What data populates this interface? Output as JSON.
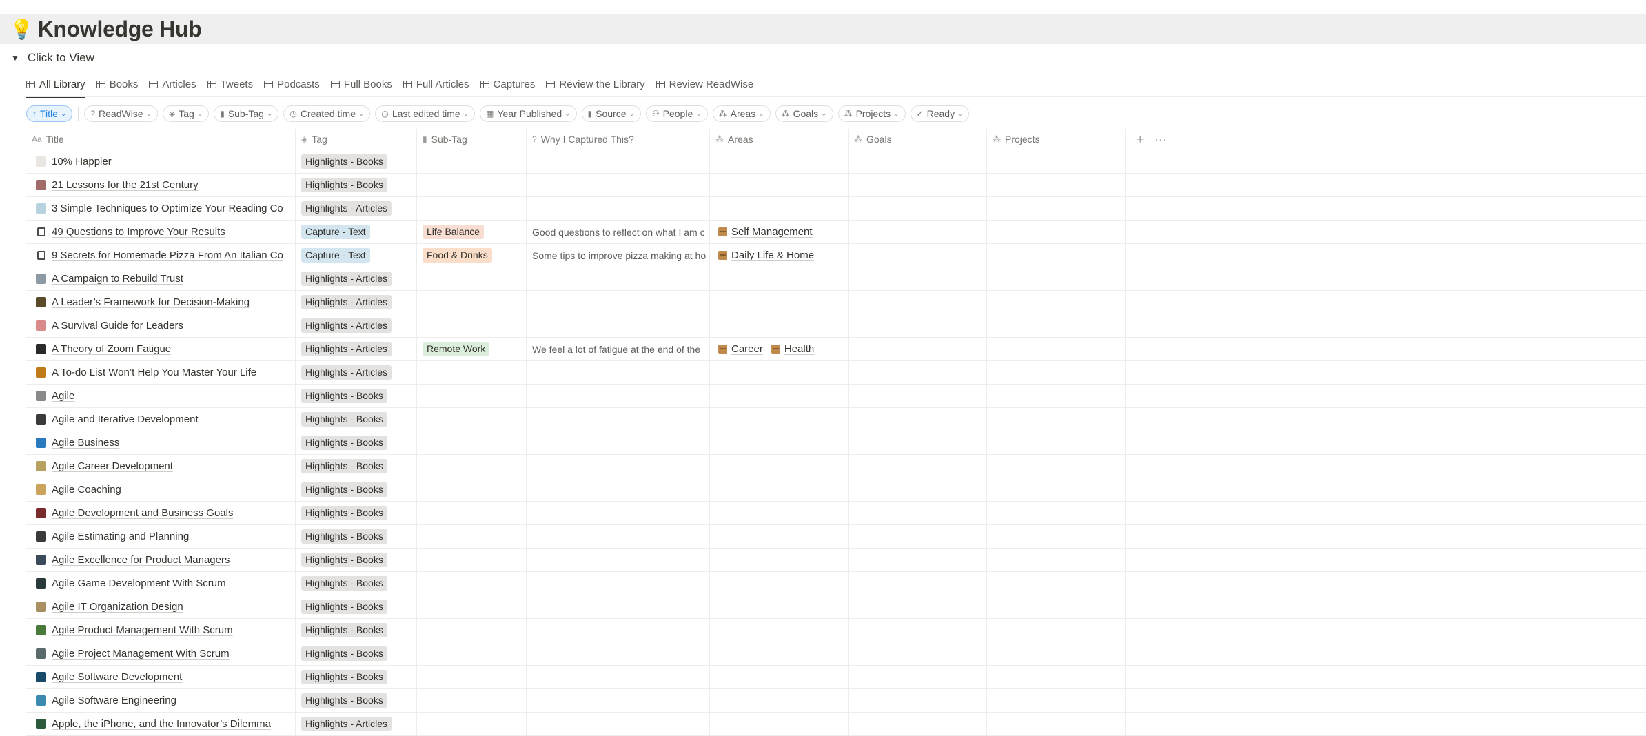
{
  "page": {
    "icon": "lightbulb-icon",
    "title": "Knowledge Hub"
  },
  "toggle": {
    "label": "Click to View"
  },
  "views": [
    {
      "label": "All Library",
      "active": true
    },
    {
      "label": "Books"
    },
    {
      "label": "Articles"
    },
    {
      "label": "Tweets"
    },
    {
      "label": "Podcasts"
    },
    {
      "label": "Full Books"
    },
    {
      "label": "Full Articles"
    },
    {
      "label": "Captures"
    },
    {
      "label": "Review the Library"
    },
    {
      "label": "Review ReadWise"
    }
  ],
  "filters": {
    "sort": {
      "label": "Title",
      "icon": "arrow-up-icon"
    },
    "items": [
      {
        "label": "ReadWise",
        "icon": "question-icon",
        "glyph": "?"
      },
      {
        "label": "Tag",
        "icon": "tag-icon",
        "glyph": "◈"
      },
      {
        "label": "Sub-Tag",
        "icon": "bag-icon",
        "glyph": "▮"
      },
      {
        "label": "Created time",
        "icon": "clock-icon",
        "glyph": "◷"
      },
      {
        "label": "Last edited time",
        "icon": "clock-icon",
        "glyph": "◷"
      },
      {
        "label": "Year Published",
        "icon": "calendar-icon",
        "glyph": "▦"
      },
      {
        "label": "Source",
        "icon": "bag-icon",
        "glyph": "▮"
      },
      {
        "label": "People",
        "icon": "people-icon",
        "glyph": "⚇"
      },
      {
        "label": "Areas",
        "icon": "relation-icon",
        "glyph": "⁂"
      },
      {
        "label": "Goals",
        "icon": "relation-icon",
        "glyph": "⁂"
      },
      {
        "label": "Projects",
        "icon": "relation-icon",
        "glyph": "⁂"
      },
      {
        "label": "Ready",
        "icon": "check-circle-icon",
        "glyph": "✓"
      }
    ]
  },
  "columns": {
    "title": "Title",
    "tag": "Tag",
    "subtag": "Sub-Tag",
    "why": "Why I Captured This?",
    "areas": "Areas",
    "goals": "Goals",
    "projects": "Projects"
  },
  "colors": {
    "tag_gray": "#e3e2e0",
    "tag_blue": "#d3e5ef",
    "life_balance": "#f7ddd2",
    "food_drinks": "#fadec9",
    "remote_work": "#dbeddb",
    "accent": "#2383e2"
  },
  "rows": [
    {
      "title": "10% Happier",
      "tag": "Highlights - Books",
      "thumb": "#e9e6e1"
    },
    {
      "title": "21 Lessons for the 21st Century",
      "tag": "Highlights - Books",
      "thumb": "#a36a6a"
    },
    {
      "title": "3 Simple Techniques to Optimize Your Reading Co",
      "tag": "Highlights - Articles",
      "thumb": "#b7d3df"
    },
    {
      "title": "49 Questions to Improve Your Results",
      "tag": "Capture - Text",
      "tag_color": "blue",
      "subtag": "Life Balance",
      "subtag_color": "life_balance",
      "why": "Good questions to reflect on what I am c",
      "areas": [
        "Self Management"
      ],
      "thumb": "#4b4b4b",
      "doc": true
    },
    {
      "title": "9 Secrets for Homemade Pizza From An Italian Co",
      "tag": "Capture - Text",
      "tag_color": "blue",
      "subtag": "Food & Drinks",
      "subtag_color": "food_drinks",
      "why": "Some tips to improve pizza making at ho",
      "areas": [
        "Daily Life & Home"
      ],
      "thumb": "#4b4b4b",
      "doc": true
    },
    {
      "title": "A Campaign to Rebuild Trust",
      "tag": "Highlights - Articles",
      "thumb": "#8c9aa6"
    },
    {
      "title": "A Leader’s Framework for Decision-Making",
      "tag": "Highlights - Articles",
      "thumb": "#5a4a2a"
    },
    {
      "title": "A Survival Guide for Leaders",
      "tag": "Highlights - Articles",
      "thumb": "#d98a8a"
    },
    {
      "title": "A Theory of Zoom Fatigue",
      "tag": "Highlights - Articles",
      "subtag": "Remote Work",
      "subtag_color": "remote_work",
      "why": "We feel a lot of fatigue at the end of the",
      "areas": [
        "Career",
        "Health"
      ],
      "thumb": "#2a2a2a"
    },
    {
      "title": "A To-do List Won’t Help You Master Your Life",
      "tag": "Highlights - Articles",
      "thumb": "#c07a1a"
    },
    {
      "title": "Agile",
      "tag": "Highlights - Books",
      "thumb": "#8a8a8a"
    },
    {
      "title": "Agile and Iterative Development",
      "tag": "Highlights - Books",
      "thumb": "#3a3a3a"
    },
    {
      "title": "Agile Business",
      "tag": "Highlights - Books",
      "thumb": "#2a7ac0"
    },
    {
      "title": "Agile Career Development",
      "tag": "Highlights - Books",
      "thumb": "#b8a060"
    },
    {
      "title": "Agile Coaching",
      "tag": "Highlights - Books",
      "thumb": "#c9a45a"
    },
    {
      "title": "Agile Development and Business Goals",
      "tag": "Highlights - Books",
      "thumb": "#7a2a2a"
    },
    {
      "title": "Agile Estimating and Planning",
      "tag": "Highlights - Books",
      "thumb": "#3a3a3a"
    },
    {
      "title": "Agile Excellence for Product Managers",
      "tag": "Highlights - Books",
      "thumb": "#3a4a5a"
    },
    {
      "title": "Agile Game Development With Scrum",
      "tag": "Highlights - Books",
      "thumb": "#2a3a3a"
    },
    {
      "title": "Agile IT Organization Design",
      "tag": "Highlights - Books",
      "thumb": "#a89060"
    },
    {
      "title": "Agile Product Management With Scrum",
      "tag": "Highlights - Books",
      "thumb": "#4a7a3a"
    },
    {
      "title": "Agile Project Management With Scrum",
      "tag": "Highlights - Books",
      "thumb": "#5a6a6a"
    },
    {
      "title": "Agile Software Development",
      "tag": "Highlights - Books",
      "thumb": "#1a4a6a"
    },
    {
      "title": "Agile Software Engineering",
      "tag": "Highlights - Books",
      "thumb": "#3a8ab0"
    },
    {
      "title": "Apple, the iPhone, and the Innovator’s Dilemma",
      "tag": "Highlights - Articles",
      "thumb": "#2a5a3a"
    }
  ]
}
